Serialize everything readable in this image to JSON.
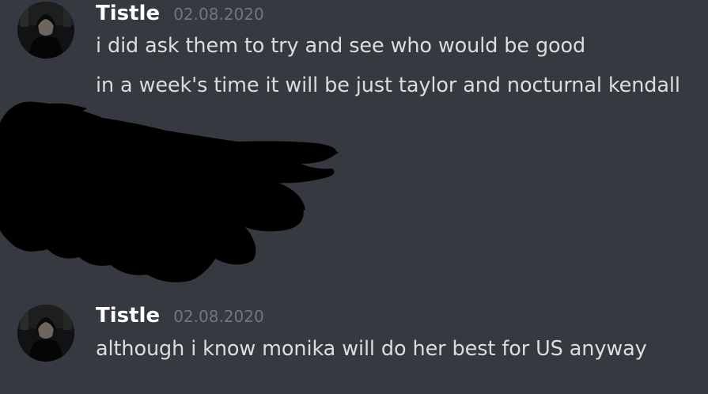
{
  "messages": [
    {
      "author": "Tistle",
      "timestamp": "02.08.2020",
      "lines": [
        "i did ask them to try and see who would be good",
        "in a week's time it will be just taylor and nocturnal kendall"
      ]
    },
    {
      "author": "Tistle",
      "timestamp": "02.08.2020",
      "lines": [
        "although i know monika will do her best for US anyway"
      ]
    }
  ],
  "colors": {
    "background": "#36393f",
    "username": "#ffffff",
    "timestamp": "#72767d",
    "message_text": "#dcddde",
    "redaction": "#000000"
  },
  "icons": {
    "avatar": "user-avatar-dark-robed-figure",
    "redaction": "black-scribble-redaction"
  }
}
